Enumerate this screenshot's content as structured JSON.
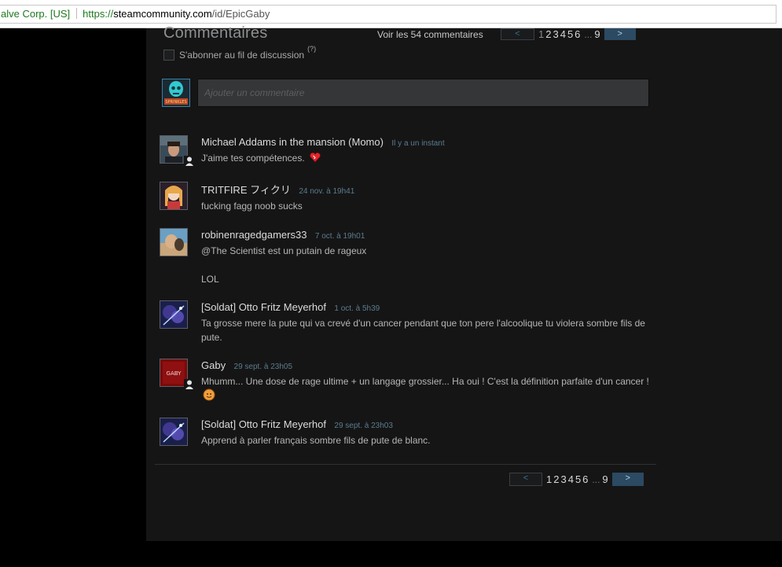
{
  "browser": {
    "cert_label": "alve Corp. [US]",
    "url_protocol": "https://",
    "url_domain": "steamcommunity.com",
    "url_path": "/id/EpicGaby"
  },
  "comments_section": {
    "title": "Commentaires",
    "view_all_label": "Voir les 54 commentaires",
    "subscribe_label": "S'abonner au fil de discussion",
    "help_label": "(?)",
    "input_placeholder": "Ajouter un commentaire",
    "my_avatar_text": "SPRINKLES"
  },
  "pagination": {
    "prev_label": "<",
    "next_label": ">",
    "pages": [
      "1",
      "2",
      "3",
      "4",
      "5",
      "6"
    ],
    "ellipsis": "...",
    "last_page": "9",
    "current_page": "1"
  },
  "comments": [
    {
      "author": "Michael Addams in the mansion (Momo)",
      "time": "Il y a un instant",
      "lines": [
        "J'aime tes compétences."
      ],
      "emote": "heart-emote",
      "friend": true
    },
    {
      "author": "TRITFIRE フィクリ",
      "time": "24 nov. à 19h41",
      "lines": [
        "fucking fagg noob sucks"
      ],
      "friend": false
    },
    {
      "author": "robinenragedgamers33",
      "time": "7 oct. à 19h01",
      "lines": [
        "@The Scientist est un putain de rageux",
        "",
        "LOL"
      ],
      "friend": false
    },
    {
      "author": "[Soldat] Otto Fritz Meyerhof",
      "time": "1 oct. à 5h39",
      "lines": [
        "Ta grosse mere la pute qui va crevé d'un cancer pendant que ton pere l'alcoolique tu violera sombre fils de pute."
      ],
      "friend": false
    },
    {
      "author": "Gaby",
      "time": "29 sept. à 23h05",
      "lines": [
        "Mhumm... Une dose de rage ultime + un langage grossier... Ha oui ! C'est la définition parfaite d'un cancer !"
      ],
      "emote": "orange-emote",
      "avatar_text": "GABY",
      "friend": true
    },
    {
      "author": "[Soldat] Otto Fritz Meyerhof",
      "time": "29 sept. à 23h03",
      "lines": [
        "Apprend à parler français sombre fils de pute de blanc."
      ],
      "friend": false
    }
  ],
  "colors": {
    "panel_bg": "#151516",
    "accent_blue": "#2c4a62",
    "author_text": "#dcdcdc",
    "timestamp": "#5c7c8c"
  }
}
